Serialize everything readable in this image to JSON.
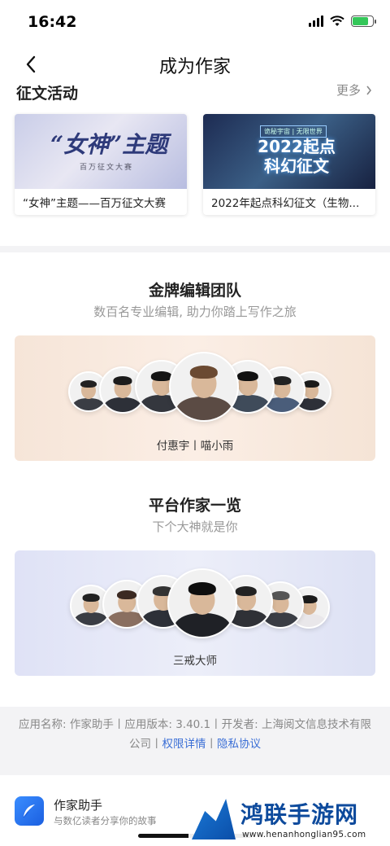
{
  "status_bar": {
    "time": "16:42",
    "battery_level": 0.8,
    "battery_color": "#34c759"
  },
  "nav": {
    "title": "成为作家",
    "back_icon": "chevron-left-icon"
  },
  "activities": {
    "title": "征文活动",
    "more_label": "更多",
    "items": [
      {
        "banner_text": "“女神”主题",
        "banner_sub": "百万征文大赛",
        "title": "“女神”主题——百万征文大赛"
      },
      {
        "banner_tag": "诡秘宇宙 | 无限世界",
        "banner_text": "2022起点科幻征文",
        "title": "2022年起点科幻征文（生物..."
      }
    ]
  },
  "editor_team": {
    "title": "金牌编辑团队",
    "subtitle": "数百名专业编辑, 助力你踏上写作之旅",
    "featured_names": "付惠宇丨喵小雨",
    "accent": "#f6e5d8"
  },
  "authors": {
    "title": "平台作家一览",
    "subtitle": "下个大神就是你",
    "featured_name": "三戒大师",
    "accent": "#dfe2f6"
  },
  "footer": {
    "info_line1": "应用名称: 作家助手丨应用版本: 3.40.1丨开发者: 上海阅文信息技术有限",
    "info_line2": "公司丨",
    "permissions_link": "权限详情",
    "separator": "丨",
    "privacy_link": "隐私协议",
    "link_color": "#3b6fd6"
  },
  "bottom_app": {
    "name": "作家助手",
    "slogan": "与数亿读者分享你的故事",
    "icon": "feather-icon"
  },
  "watermark": {
    "title": "鸿联手游网",
    "url": "www.henanhonglian95.com"
  }
}
